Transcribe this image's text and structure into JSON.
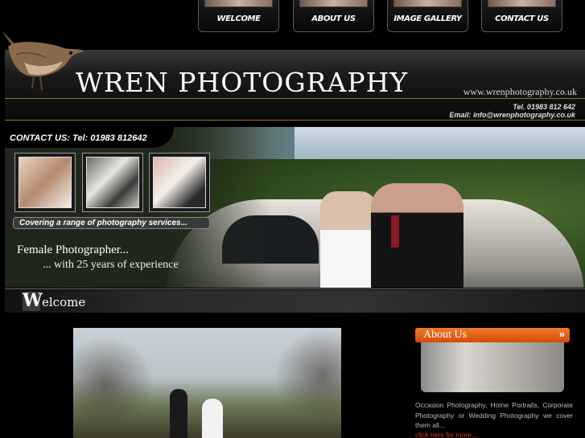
{
  "nav": {
    "items": [
      {
        "label": "WELCOME"
      },
      {
        "label": "ABOUT US"
      },
      {
        "label": "IMAGE GALLERY"
      },
      {
        "label": "CONTACT US"
      }
    ]
  },
  "header": {
    "title": "WREN PHOTOGRAPHY",
    "url": "www.wrenphotography.co.uk",
    "tel": "Tel. 01983 812 642",
    "email": "Email: info@wrenphotography.co.uk"
  },
  "banner": {
    "contact_label": "CONTACT US:",
    "contact_tel": "Tel: 01983 812642",
    "services": "Covering a range of photography services...",
    "female_line1": "Female Photographer...",
    "female_line2": "... with 25 years of experience"
  },
  "welcome": {
    "initial": "W",
    "rest": "elcome"
  },
  "about": {
    "title": "About Us",
    "chevron": "»",
    "text": "Occasion Photography, Home Portraits, Corporate Photography or Wedding Photography we cover them all...",
    "more": "click here for more..."
  },
  "colors": {
    "accent_orange": "#e8641c",
    "link_red": "#e23a1a",
    "gold_rule": "#8a7430"
  }
}
